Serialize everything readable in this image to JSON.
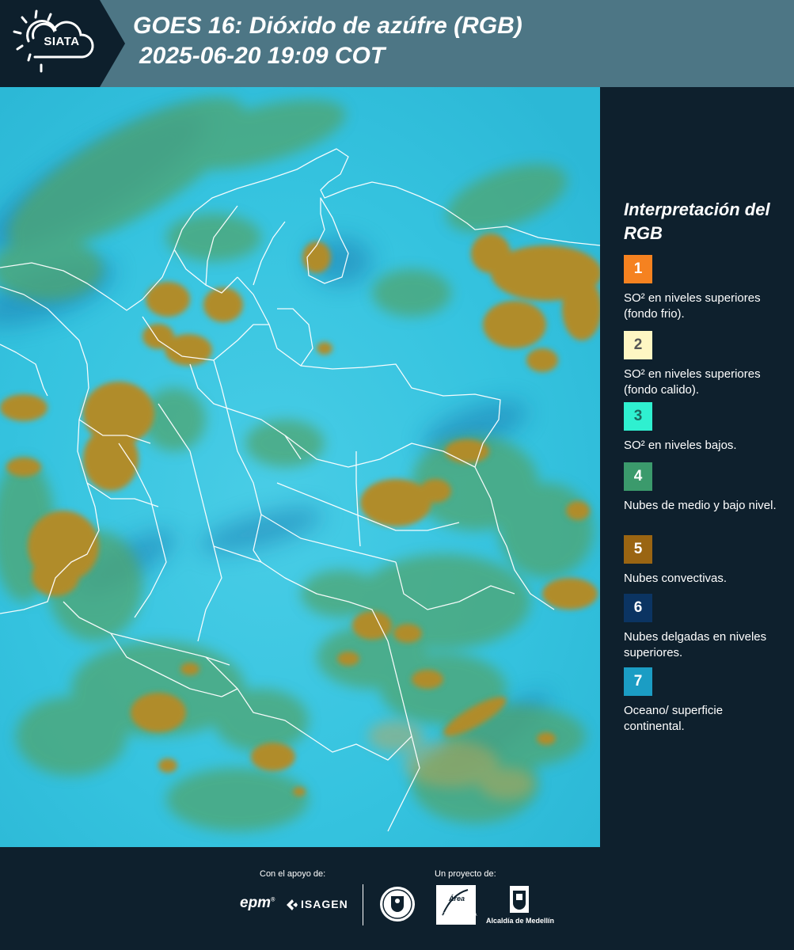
{
  "header": {
    "logo_text": "SIATA",
    "title_line1": "GOES 16: Dióxido de azúfre (RGB)",
    "title_line2": "2025-06-20 19:09 COT",
    "background_color": "#4d7685",
    "logo_background_color": "#0d1f2c"
  },
  "map": {
    "description_color_background": "#33c6e2",
    "cloud_color_convective": "#b08c2a",
    "cloud_color_low": "#49a87a",
    "border_color": "#ffffff"
  },
  "legend": {
    "title": "Interpretación del RGB",
    "items": [
      {
        "number": "1",
        "label": "SO² en niveles superiores (fondo frio).",
        "color": "#f58220",
        "text_color": "#ffffff"
      },
      {
        "number": "2",
        "label": "SO² en niveles superiores (fondo calido).",
        "color": "#fef6c3",
        "text_color": "#555555"
      },
      {
        "number": "3",
        "label": "SO² en niveles bajos.",
        "color": "#2ff0d0",
        "text_color": "#1a6a60"
      },
      {
        "number": "4",
        "label": "Nubes de medio y bajo nivel.",
        "color": "#3b9a6c",
        "text_color": "#ffffff"
      },
      {
        "number": "5",
        "label": "Nubes convectivas.",
        "color": "#9a6512",
        "text_color": "#ffffff"
      },
      {
        "number": "6",
        "label": "Nubes delgadas en niveles superiores.",
        "color": "#0b3462",
        "text_color": "#ffffff"
      },
      {
        "number": "7",
        "label": "Oceano/ superficie continental.",
        "color": "#1b9dc4",
        "text_color": "#ffffff"
      }
    ]
  },
  "footer": {
    "support_caption": "Con el apoyo de:",
    "project_caption": "Un proyecto de:",
    "brand_epm": "epm",
    "brand_isagen": "ISAGEN",
    "brand_area": "Área",
    "brand_area_sub": "METROPOLITANA Valle de Aburrá",
    "brand_alcaldia": "Alcaldía de Medellín"
  }
}
